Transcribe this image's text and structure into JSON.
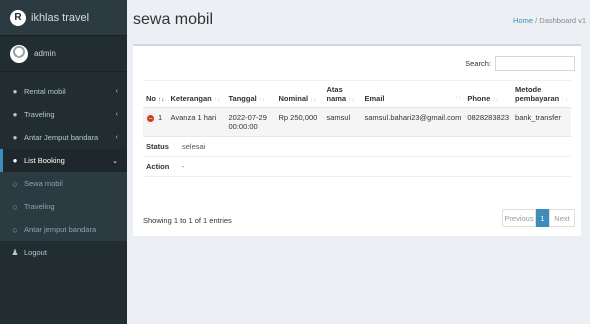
{
  "brand": {
    "logo_letter": "R",
    "title": "ikhlas travel"
  },
  "user": {
    "name": "admin"
  },
  "menu": [
    {
      "label": "Rental mobil",
      "icon": "car-icon",
      "chevron": "‹"
    },
    {
      "label": "Traveling",
      "icon": "car-icon",
      "chevron": "‹"
    },
    {
      "label": "Antar Jemput bandara",
      "icon": "car-icon",
      "chevron": "‹"
    },
    {
      "label": "List Booking",
      "icon": "car-icon",
      "chevron": "⌄"
    }
  ],
  "submenu": [
    {
      "label": "Sewa mobil",
      "icon": "circle-icon"
    },
    {
      "label": "Traveling",
      "icon": "circle-icon"
    },
    {
      "label": "Antar jemput bandara",
      "icon": "circle-icon"
    }
  ],
  "logout": {
    "label": "Logout",
    "icon": "user-icon"
  },
  "page": {
    "title": "sewa mobil"
  },
  "breadcrumb": {
    "home": "Home",
    "separator": "/",
    "current": "Dashboard v1"
  },
  "search": {
    "label": "Search:",
    "value": ""
  },
  "table": {
    "headers": {
      "no": "No",
      "keterangan": "Keterangan",
      "tanggal": "Tanggal",
      "nominal": "Nominal",
      "atas_nama_1": "Atas",
      "atas_nama_2": "nama",
      "email": "Email",
      "phone": "Phone",
      "metode_1": "Metode",
      "metode_2": "pembayaran"
    },
    "row": {
      "no": "1",
      "keterangan": "Avanza 1 hari",
      "tanggal_1": "2022-07-29",
      "tanggal_2": "00:00:00",
      "nominal": "Rp 250,000",
      "atas_nama": "samsul",
      "email": "samsul.bahari23@gmail.com",
      "phone": "0828283823",
      "metode": "bank_transfer"
    },
    "expander_symbol": "−",
    "child": {
      "status_key": "Status",
      "status_val": "selesai",
      "action_key": "Action",
      "action_val": "-"
    }
  },
  "info": "Showing 1 to 1 of 1 entries",
  "pagination": {
    "previous": "Previous",
    "page": "1",
    "next": "Next"
  },
  "colors": {
    "sidebar": "#222d32",
    "accent": "#3c8dbc",
    "expander": "#d33724",
    "background": "#ecf0f5"
  }
}
